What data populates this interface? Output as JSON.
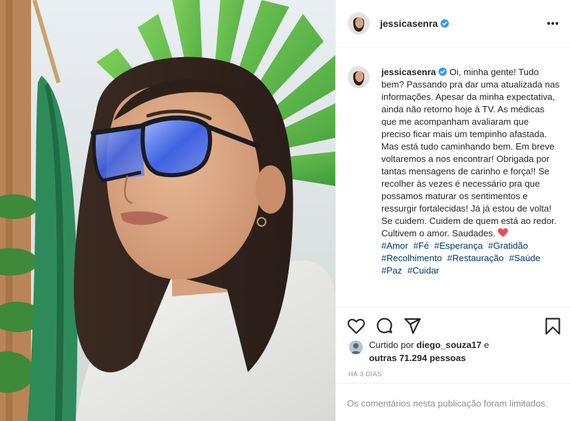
{
  "post": {
    "username": "jessicasenra",
    "verified": true,
    "caption": "Oi, minha gente! Tudo bem? Passando pra dar uma atualizada nas informações. Apesar da minha expectativa, ainda não retorno hoje à TV. As médicas que me acompanham avaliaram que preciso ficar mais um tempinho afastada. Mas está tudo caminhando bem. Em breve voltaremos a nos encontrar! Obrigada por tantas mensagens de carinho e força!! Se recolher às vezes é necessário pra que possamos maturar os sentimentos e ressurgir fortalecidas! Já já estou de volta! Se cuidem. Cuidem de quem está ao redor. Cultivem o amor. Saudades.",
    "caption_emoji": "red-heart",
    "hashtags": [
      "#Amor",
      "#Fé",
      "#Esperança",
      "#Gratidão",
      "#Recolhimento",
      "#Restauração",
      "#Saúde",
      "#Paz",
      "#Cuidar"
    ]
  },
  "likes": {
    "prefix": "Curtido por",
    "liker": "diego_souza17",
    "conjunction": "e",
    "others": "outras 71.294 pessoas"
  },
  "timestamp": "HÁ 3 DIAS",
  "comments_notice": "Os comentários nesta publicação foram limitados.",
  "icons": {
    "more": "more-options-icon",
    "like": "heart-outline-icon",
    "comment": "comment-icon",
    "share": "paper-plane-icon",
    "save": "bookmark-icon",
    "verified": "verified-badge-icon"
  },
  "colors": {
    "text": "#262626",
    "secondary": "#8e8e8e",
    "hashtag": "#00376b",
    "verified": "#3897f0",
    "heart": "#ed4956",
    "border": "#efefef"
  }
}
